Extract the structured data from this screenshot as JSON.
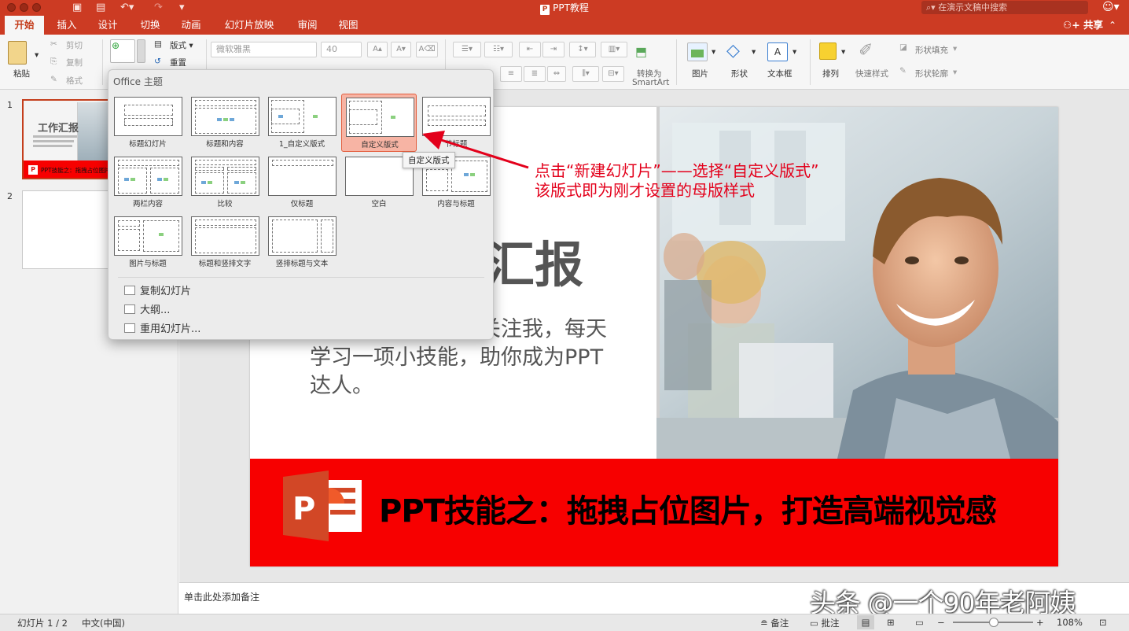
{
  "window": {
    "title": "PPT教程",
    "search_placeholder": "在演示文稿中搜索"
  },
  "tabs": [
    {
      "label": "开始",
      "active": true
    },
    {
      "label": "插入"
    },
    {
      "label": "设计"
    },
    {
      "label": "切换"
    },
    {
      "label": "动画"
    },
    {
      "label": "幻灯片放映"
    },
    {
      "label": "审阅"
    },
    {
      "label": "视图"
    }
  ],
  "share_label": "共享",
  "ribbon": {
    "paste": "粘贴",
    "cut": "剪切",
    "copy": "复制",
    "format": "格式",
    "layout": "版式",
    "reset": "重置",
    "font_name": "微软雅黑",
    "font_size": "40",
    "convert_smartart_1": "转换为",
    "convert_smartart_2": "SmartArt",
    "picture": "图片",
    "shape": "形状",
    "textbox": "文本框",
    "arrange": "排列",
    "quick_styles": "快速样式",
    "shape_fill": "形状填充",
    "shape_outline": "形状轮廓"
  },
  "thumbnails": [
    {
      "number": "1",
      "title": "工作汇报",
      "band_text": "PPT技能之：拖拽占位图片"
    },
    {
      "number": "2"
    }
  ],
  "gallery": {
    "header": "Office 主题",
    "layouts": [
      {
        "name": "标题幻灯片"
      },
      {
        "name": "标题和内容"
      },
      {
        "name": "1_自定义版式"
      },
      {
        "name": "自定义版式",
        "selected": true
      },
      {
        "name": "节标题"
      },
      {
        "name": "两栏内容"
      },
      {
        "name": "比较"
      },
      {
        "name": "仅标题"
      },
      {
        "name": "空白"
      },
      {
        "name": "内容与标题"
      },
      {
        "name": "图片与标题"
      },
      {
        "name": "标题和竖排文字"
      },
      {
        "name": "竖排标题与文本"
      }
    ],
    "menu": [
      "复制幻灯片",
      "大纲...",
      "重用幻灯片..."
    ],
    "tooltip": "自定义版式"
  },
  "annotation": {
    "line1": "点击“新建幻灯片”——选择“自定义版式”",
    "line2": "该版式即为刚才设置的母版样式",
    "color": "#e3001b"
  },
  "slide": {
    "title_visible": "汇报",
    "body": "对您有所帮助，请关注我，每天学习一项小技能，助你成为PPT达人。",
    "band_text": "PPT技能之：拖拽占位图片，打造高端视觉感",
    "band_color": "#f70000"
  },
  "notes_placeholder": "单击此处添加备注",
  "watermark": "头条 @一个90年老阿姨",
  "status": {
    "slide_count": "幻灯片 1 / 2",
    "language": "中文(中国)",
    "notes": "备注",
    "comments": "批注",
    "zoom": "108%"
  },
  "colors": {
    "accent": "#cc3b23",
    "ribbon_bg": "#f6f6f6"
  }
}
